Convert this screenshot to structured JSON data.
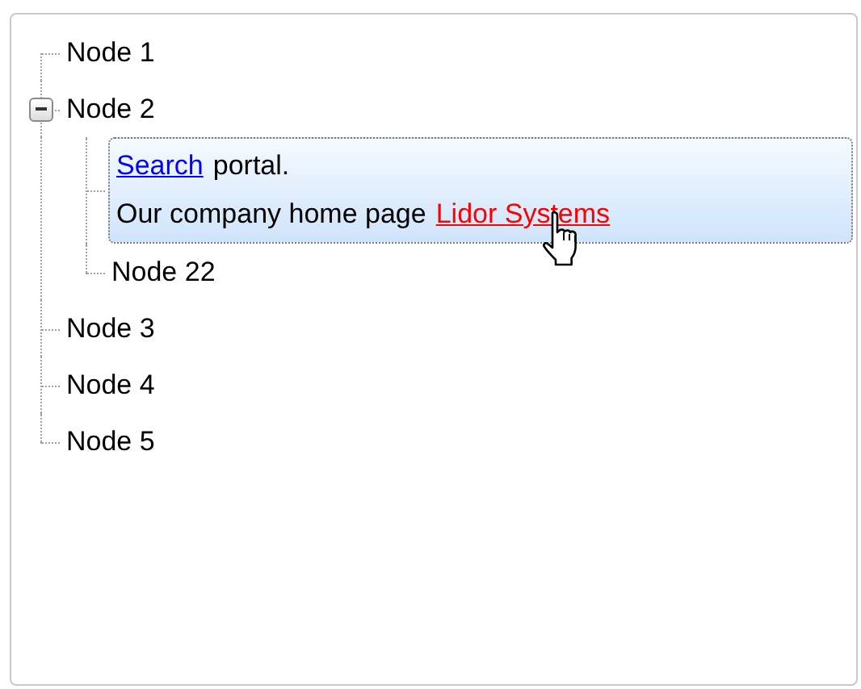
{
  "tree": {
    "nodes": [
      {
        "kind": "text",
        "label": "Node 1",
        "selected": false
      },
      {
        "kind": "text",
        "label": "Node 2",
        "selected": false,
        "expanded": true,
        "children": [
          {
            "kind": "rich",
            "selected": true,
            "lines": [
              [
                {
                  "kind": "link",
                  "text": "Search",
                  "hovered": false
                },
                {
                  "kind": "text",
                  "text": "portal."
                }
              ],
              [
                {
                  "kind": "text",
                  "text": "Our company home page"
                },
                {
                  "kind": "link",
                  "text": "Lidor Systems",
                  "hovered": true
                }
              ]
            ]
          },
          {
            "kind": "text",
            "label": "Node 22",
            "selected": false
          }
        ]
      },
      {
        "kind": "text",
        "label": "Node 3",
        "selected": false
      },
      {
        "kind": "text",
        "label": "Node 4",
        "selected": false
      },
      {
        "kind": "text",
        "label": "Node 5",
        "selected": false
      }
    ]
  }
}
